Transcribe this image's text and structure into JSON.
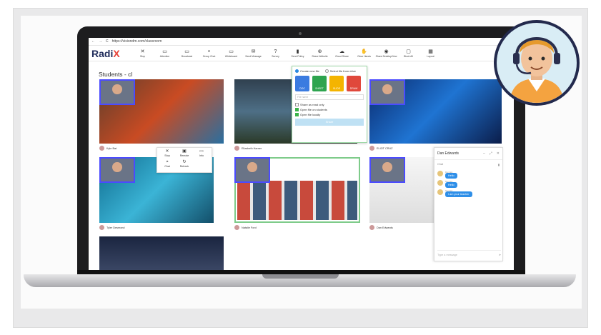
{
  "browser": {
    "url": "https://visiondm.com/classroom",
    "nav_back": "←",
    "nav_forward": "→",
    "nav_reload": "C"
  },
  "app": {
    "logo_main": "Radi",
    "logo_accent": "X",
    "page_title": "Students - cl"
  },
  "toolbar": [
    {
      "label": "Stop",
      "icon": "✕"
    },
    {
      "label": "Attention",
      "icon": "▭"
    },
    {
      "label": "Broadcast",
      "icon": "▭"
    },
    {
      "label": "Group Chat",
      "icon": "◓"
    },
    {
      "label": "Whiteboard",
      "icon": "▭"
    },
    {
      "label": "Send Message",
      "icon": "✉"
    },
    {
      "label": "Survey",
      "icon": "?"
    },
    {
      "label": "Send Policy",
      "icon": "▮"
    },
    {
      "label": "Share Website",
      "icon": "⊕"
    },
    {
      "label": "Cloud Share",
      "icon": "☁"
    },
    {
      "label": "Clear Hands",
      "icon": "✋"
    },
    {
      "label": "Share Desktop/Vew",
      "icon": "◉"
    },
    {
      "label": "Block All",
      "icon": "▢"
    },
    {
      "label": "Layout",
      "icon": "▦"
    }
  ],
  "students": [
    {
      "name": "Kyle Bat"
    },
    {
      "name": "Elizabeth Harner"
    },
    {
      "name": "ELIOT CRUZ"
    },
    {
      "name": "Tyler Desmond"
    },
    {
      "name": "Natalie Ford"
    },
    {
      "name": "Dan Edwards"
    }
  ],
  "cloud_share": {
    "option_create": "Create new file",
    "option_select": "Select file from drive",
    "file_types": [
      {
        "label": "DOC",
        "color": "#3a7be0"
      },
      {
        "label": "SHEET",
        "color": "#2ea44f"
      },
      {
        "label": "SLIDE",
        "color": "#f4b400"
      },
      {
        "label": "DRAW",
        "color": "#e0483b"
      }
    ],
    "file_name_placeholder": "File name",
    "checks": [
      {
        "label": "Share as read only",
        "checked": false
      },
      {
        "label": "Open file on students",
        "checked": true
      },
      {
        "label": "Open file locally",
        "checked": true
      }
    ],
    "done_label": "Share"
  },
  "context_menu": [
    {
      "label": "Stop",
      "icon": "✕"
    },
    {
      "label": "Remote",
      "icon": "▣"
    },
    {
      "label": "Info",
      "icon": "▭"
    },
    {
      "label": "Chat",
      "icon": "◓"
    },
    {
      "label": "Refresh",
      "icon": "↻"
    }
  ],
  "chat": {
    "title": "Dan Edwards",
    "subtitle": "Chat",
    "messages": [
      {
        "who": "Dan Ed.",
        "text": "Hello"
      },
      {
        "who": "Dan Ed.",
        "text": "Hello"
      },
      {
        "who": "Dan Ed.",
        "text": "I am your teacher"
      }
    ],
    "input_placeholder": "Type a message"
  },
  "colors": {
    "brand": "#1f2b5a",
    "accent": "#e8443a",
    "highlight": "#4b4bff",
    "chat_bubble": "#2f8fe8"
  }
}
